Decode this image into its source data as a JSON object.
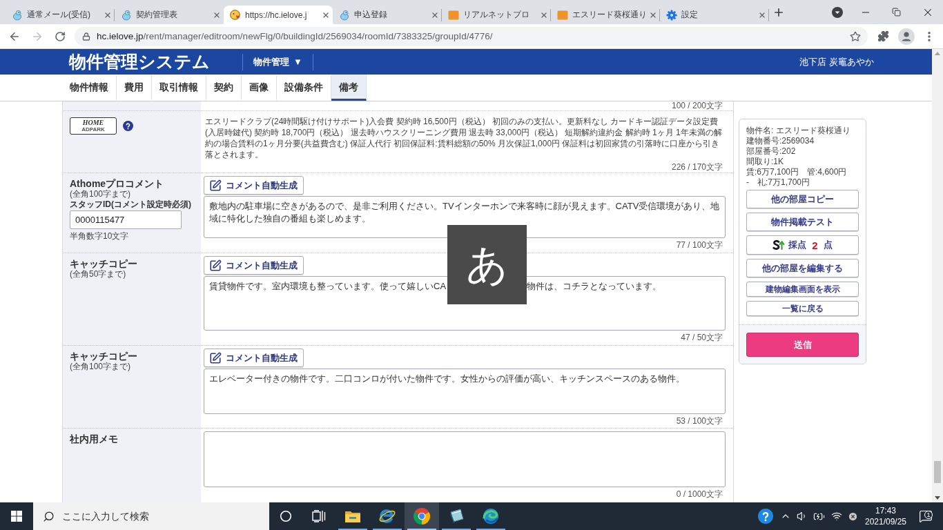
{
  "browser": {
    "tabs": [
      {
        "title": "通常メール(受信)",
        "kind": "bird",
        "selected": false
      },
      {
        "title": "契約管理表",
        "kind": "bird",
        "selected": false
      },
      {
        "title": "https://hc.ielove.j",
        "kind": "chick",
        "selected": true
      },
      {
        "title": "申込登録",
        "kind": "bird",
        "selected": false
      },
      {
        "title": "リアルネットプロ",
        "kind": "tile",
        "selected": false
      },
      {
        "title": "エスリード葵桜通り",
        "kind": "tile",
        "selected": false
      },
      {
        "title": "設定",
        "kind": "gear",
        "selected": false
      }
    ],
    "url": {
      "domain": "hc.ielove.jp",
      "path": "/rent/manager/editroom/newFlg/0/buildingId/2569034/roomId/7383325/groupId/4776/"
    }
  },
  "header": {
    "title": "物件管理システム",
    "menu": {
      "label": "物件管理",
      "caret": "▼"
    },
    "user": "池下店 炭竈あやか"
  },
  "nav": [
    {
      "label": "物件情報",
      "selected": false
    },
    {
      "label": "費用",
      "selected": false
    },
    {
      "label": "取引情報",
      "selected": false
    },
    {
      "label": "契約",
      "selected": false
    },
    {
      "label": "画像",
      "selected": false
    },
    {
      "label": "設備条件",
      "selected": false
    },
    {
      "label": "備考",
      "selected": true
    }
  ],
  "content": {
    "previous_counter": "100 / 200文字",
    "sections": [
      {
        "kind": "text",
        "logo": {
          "line_1": "HOME",
          "line_2": "ADPARK"
        },
        "text": "エスリードクラブ(24時間駆け付けサポート)入会費 契約時 16,500円（税込） 初回のみの支払い。更新料なし カードキー認証データ設定費(入居時鍵代) 契約時 18,700円（税込） 退去時ハウスクリーニング費用 退去時 33,000円（税込） 短期解約違約金 解約時 1ヶ月 1年未満の解約の場合賃料の1ヶ月分要(共益費含む) 保証人代行 初回保証料:賃料総額の50% 月次保証1,000円 保証料は初回家賃の引落時に口座から引き落とされます。",
        "counter": "226 / 170文字"
      },
      {
        "kind": "comment",
        "label": "Athomeプロコメント",
        "note": "(全角100字まで)",
        "staff_id": {
          "label": "スタッフID(コメント設定時必須)",
          "value": "0000115477",
          "hint": "半角数字10文字"
        },
        "button": "コメント自動生成",
        "segments": [
          "敷地内の駐車場に空きがあるので、是非ご利用ください。TVインターホンで来客時に顔が見えます。CATV受信環境があり、地域に特化した独自の番組も楽しめます。"
        ],
        "counter": "77 / 100文字"
      },
      {
        "kind": "comment",
        "label": "キャッチコピー",
        "note": "(全角50字まで)",
        "button": "コメント自動生成",
        "segments": [
          "賃貸物件です。室内環境も整っています。使って嬉しいCA",
          "物件は、コチラとなっています。"
        ],
        "ime_indicator": "あ",
        "counter": "47 / 50文字"
      },
      {
        "kind": "comment",
        "label": "キャッチコピー",
        "note": "(全角100字まで)",
        "button": "コメント自動生成",
        "segments": [
          "エレベーター付きの物件です。二口コンロが付いた物件です。女性からの評価が高い、キッチンスペースのある物件。"
        ],
        "counter": "53 / 100文字"
      },
      {
        "kind": "memo",
        "label": "社内用メモ",
        "counter": "0 / 1000文字"
      }
    ]
  },
  "sidebar": {
    "info": [
      "物件名: エスリード葵桜通り",
      "建物番号:2569034",
      "部屋番号:202",
      "間取り:1K",
      "賃:6万7,100円　管:4,600円",
      "-　礼:7万1,700円"
    ],
    "buttons": [
      {
        "kind": "plain",
        "label": "他の部屋コピー"
      },
      {
        "kind": "plain",
        "label": "物件掲載テスト"
      },
      {
        "kind": "score",
        "label": "採点",
        "score": "2",
        "unit": "点"
      },
      {
        "kind": "plain",
        "label": "他の部屋を編集する"
      },
      {
        "kind": "small",
        "label": "建物編集画面を表示"
      },
      {
        "kind": "small",
        "label": "一覧に戻る"
      }
    ],
    "submit": "送信"
  },
  "taskbar": {
    "search": {
      "placeholder": "ここに入力して検索"
    },
    "apps": [
      {
        "kind": "cortana",
        "running": false,
        "active": false
      },
      {
        "kind": "task_view",
        "running": false,
        "active": false
      },
      {
        "kind": "folder",
        "running": true,
        "active": false
      },
      {
        "kind": "ie",
        "running": true,
        "active": false
      },
      {
        "kind": "chrome",
        "running": true,
        "active": true
      },
      {
        "kind": "notebook",
        "running": true,
        "active": false
      },
      {
        "kind": "edge",
        "running": true,
        "active": false
      }
    ],
    "time": "17:43",
    "date": "2021/09/25",
    "notifications": "1"
  }
}
